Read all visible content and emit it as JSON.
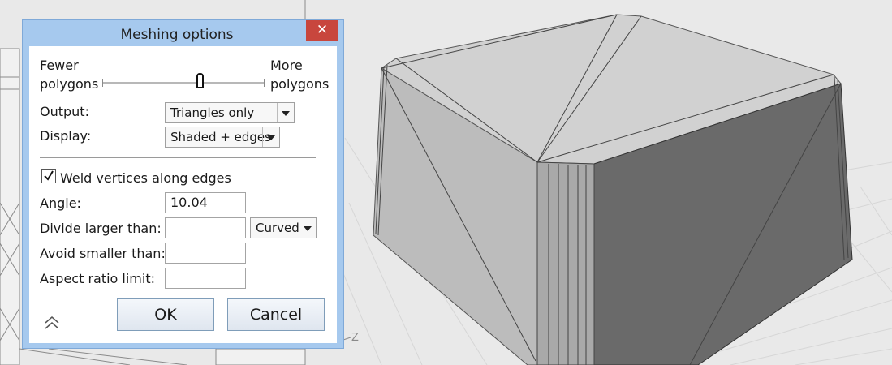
{
  "dialog": {
    "title": "Meshing options",
    "close_glyph": "✕",
    "slider": {
      "left_label_line1": "Fewer",
      "left_label_line2": "polygons",
      "right_label_line1": "More",
      "right_label_line2": "polygons",
      "value_fraction": 0.6
    },
    "output": {
      "label": "Output:",
      "value": "Triangles only"
    },
    "display": {
      "label": "Display:",
      "value": "Shaded + edges"
    },
    "weld": {
      "label": "Weld vertices along edges",
      "checked": true
    },
    "angle": {
      "label": "Angle:",
      "value": "10.04"
    },
    "divide": {
      "label": "Divide larger than:",
      "value": "",
      "mode": "Curved"
    },
    "avoid": {
      "label": "Avoid smaller than:",
      "value": ""
    },
    "aspect": {
      "label": "Aspect ratio limit:",
      "value": ""
    },
    "ok_label": "OK",
    "cancel_label": "Cancel",
    "collapse_icon": "double-chevron-up-icon"
  },
  "viewport": {
    "axis_label": "Z"
  },
  "colors": {
    "title_bar": "#a6c9ee",
    "close_button": "#c8463d",
    "viewport_bg": "#e9e9e9",
    "model_top": "#d1d1d1",
    "model_side_light": "#bcbcbc",
    "model_side_dark": "#6a6a6a"
  }
}
